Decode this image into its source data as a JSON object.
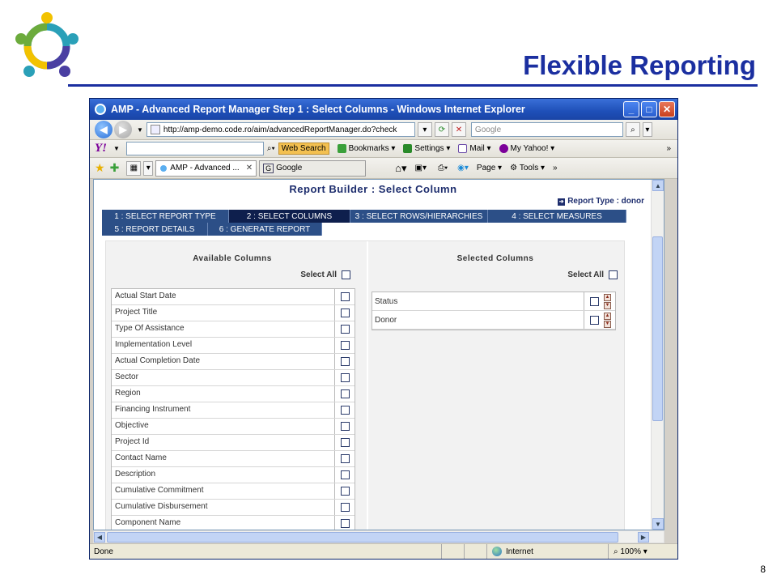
{
  "slide": {
    "title": "Flexible Reporting",
    "page_number": "8",
    "colors": {
      "title": "#1b2fa0",
      "logo_teal": "#2aa0b8",
      "logo_green": "#6cab3c",
      "logo_yellow": "#f2c200",
      "logo_purple": "#4a3fa2"
    }
  },
  "browser": {
    "window_title": "AMP - Advanced Report Manager Step 1 : Select Columns - Windows Internet Explorer",
    "address": "http://amp-demo.code.ro/aim/advancedReportManager.do?check",
    "search_placeholder": "Google",
    "yahoo_logo": "Y!",
    "web_search_label": "Web Search",
    "bookmarks_label": "Bookmarks",
    "settings_label": "Settings",
    "mail_label": "Mail",
    "my_yahoo_label": "My Yahoo!",
    "more_label": "»",
    "tabs": [
      {
        "label": "AMP - Advanced ..."
      },
      {
        "label": "Google"
      }
    ],
    "page_label": "Page",
    "tools_label": "Tools",
    "status_text": "Done",
    "zone_text": "Internet",
    "zoom_text": "100%"
  },
  "report": {
    "title": "Report Builder : Select Column",
    "report_type": "Report Type : donor",
    "steps_row1": [
      {
        "label": "1 : SELECT REPORT TYPE",
        "active": false
      },
      {
        "label": "2 : SELECT COLUMNS",
        "active": true
      },
      {
        "label": "3 : SELECT ROWS/HIERARCHIES",
        "active": false
      },
      {
        "label": "4 : SELECT MEASURES",
        "active": false
      }
    ],
    "steps_row2": [
      {
        "label": "5 : REPORT DETAILS",
        "active": false
      },
      {
        "label": "6 : GENERATE REPORT",
        "active": false
      }
    ],
    "available_header": "Available Columns",
    "selected_header": "Selected Columns",
    "select_all_label": "Select All",
    "available_columns": [
      "Actual Start Date",
      "Project Title",
      "Type Of Assistance",
      "Implementation Level",
      "Actual Completion Date",
      "Sector",
      "Region",
      "Financing Instrument",
      "Objective",
      "Project Id",
      "Contact Name",
      "Description",
      "Cumulative Commitment",
      "Cumulative Disbursement",
      "Component Name"
    ],
    "selected_columns": [
      "Status",
      "Donor"
    ]
  }
}
